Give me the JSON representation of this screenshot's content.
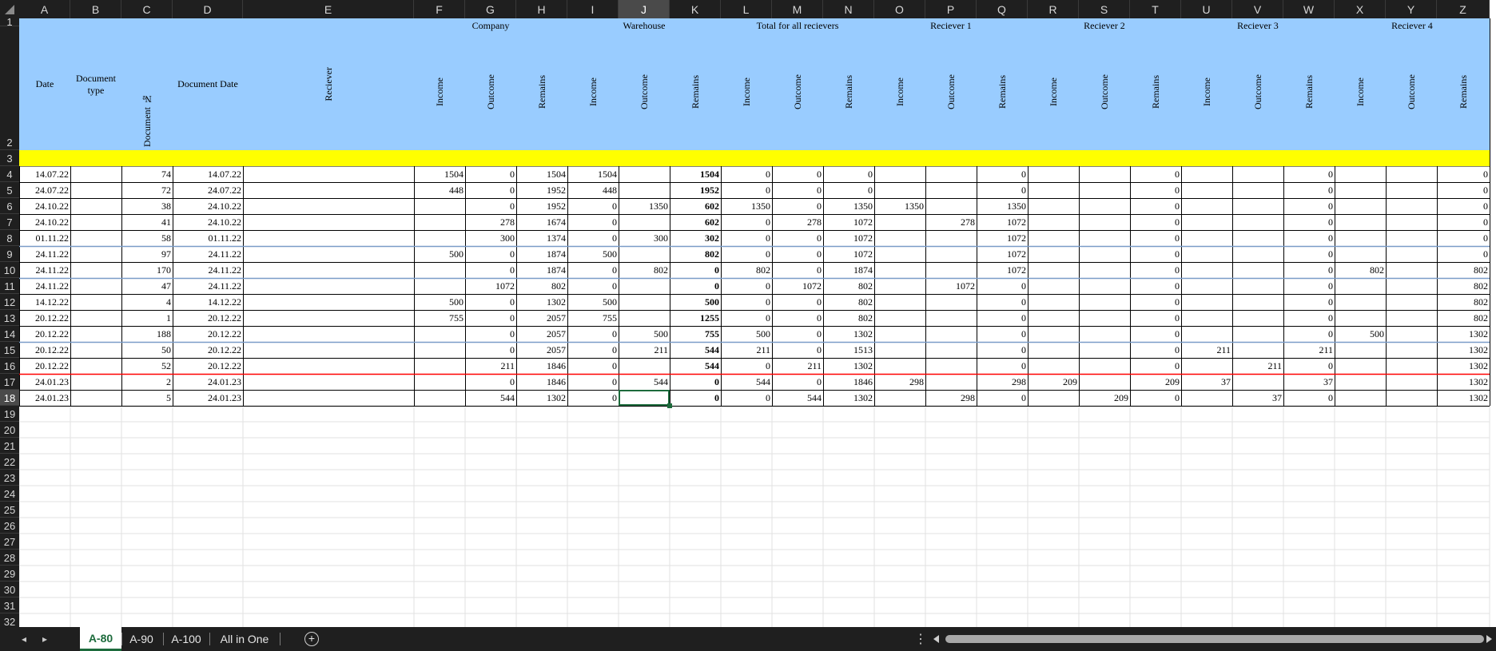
{
  "columns": [
    "A",
    "B",
    "C",
    "D",
    "E",
    "F",
    "G",
    "H",
    "I",
    "J",
    "K",
    "L",
    "M",
    "N",
    "O",
    "P",
    "Q",
    "R",
    "S",
    "T",
    "U",
    "V",
    "W",
    "X",
    "Y",
    "Z"
  ],
  "selected_column": "J",
  "selected_row": 18,
  "rows": [
    "1",
    "2",
    "3",
    "4",
    "5",
    "6",
    "7",
    "8",
    "9",
    "10",
    "11",
    "12",
    "13",
    "14",
    "15",
    "16",
    "17",
    "18",
    "19",
    "20",
    "21",
    "22",
    "23",
    "24",
    "25",
    "26",
    "27",
    "28",
    "29",
    "30",
    "31",
    "32"
  ],
  "headers": {
    "date": "Date",
    "document_type": "Document type",
    "document_no": "Document №",
    "document_date": "Document Date",
    "reciever": "Reciever",
    "groups": [
      "Company",
      "Warehouse",
      "Total for all recievers",
      "Reciever 1",
      "Reciever 2",
      "Reciever 3",
      "Reciever 4"
    ],
    "sub": [
      "Income",
      "Outcome",
      "Remains"
    ]
  },
  "colors": {
    "header_fill": "#99ccff",
    "highlight_row": "#ffff00",
    "red_line": "#ff0000",
    "blue_line": "#7a9cc8",
    "selection": "#1d6b3c"
  },
  "data_rows": [
    {
      "A": "14.07.22",
      "C": "74",
      "D": "14.07.22",
      "F": "1504",
      "G": "0",
      "H": "1504",
      "I": "1504",
      "J": "",
      "K": "1504",
      "L": "0",
      "M": "0",
      "N": "0",
      "O": "",
      "P": "",
      "Q": "0",
      "R": "",
      "S": "",
      "T": "0",
      "U": "",
      "V": "",
      "W": "0",
      "X": "",
      "Y": "",
      "Z": "0"
    },
    {
      "A": "24.07.22",
      "C": "72",
      "D": "24.07.22",
      "F": "448",
      "G": "0",
      "H": "1952",
      "I": "448",
      "J": "",
      "K": "1952",
      "L": "0",
      "M": "0",
      "N": "0",
      "O": "",
      "P": "",
      "Q": "0",
      "R": "",
      "S": "",
      "T": "0",
      "U": "",
      "V": "",
      "W": "0",
      "X": "",
      "Y": "",
      "Z": "0"
    },
    {
      "A": "24.10.22",
      "C": "38",
      "D": "24.10.22",
      "F": "",
      "G": "0",
      "H": "1952",
      "I": "0",
      "J": "1350",
      "K": "602",
      "L": "1350",
      "M": "0",
      "N": "1350",
      "O": "1350",
      "P": "",
      "Q": "1350",
      "R": "",
      "S": "",
      "T": "0",
      "U": "",
      "V": "",
      "W": "0",
      "X": "",
      "Y": "",
      "Z": "0"
    },
    {
      "A": "24.10.22",
      "C": "41",
      "D": "24.10.22",
      "F": "",
      "G": "278",
      "H": "1674",
      "I": "0",
      "J": "",
      "K": "602",
      "L": "0",
      "M": "278",
      "N": "1072",
      "O": "",
      "P": "278",
      "Q": "1072",
      "R": "",
      "S": "",
      "T": "0",
      "U": "",
      "V": "",
      "W": "0",
      "X": "",
      "Y": "",
      "Z": "0"
    },
    {
      "A": "01.11.22",
      "C": "58",
      "D": "01.11.22",
      "F": "",
      "G": "300",
      "H": "1374",
      "I": "0",
      "J": "300",
      "K": "302",
      "L": "0",
      "M": "0",
      "N": "1072",
      "O": "",
      "P": "",
      "Q": "1072",
      "R": "",
      "S": "",
      "T": "0",
      "U": "",
      "V": "",
      "W": "0",
      "X": "",
      "Y": "",
      "Z": "0"
    },
    {
      "A": "24.11.22",
      "C": "97",
      "D": "24.11.22",
      "F": "500",
      "G": "0",
      "H": "1874",
      "I": "500",
      "J": "",
      "K": "802",
      "L": "0",
      "M": "0",
      "N": "1072",
      "O": "",
      "P": "",
      "Q": "1072",
      "R": "",
      "S": "",
      "T": "0",
      "U": "",
      "V": "",
      "W": "0",
      "X": "",
      "Y": "",
      "Z": "0"
    },
    {
      "A": "24.11.22",
      "C": "170",
      "D": "24.11.22",
      "F": "",
      "G": "0",
      "H": "1874",
      "I": "0",
      "J": "802",
      "K": "0",
      "L": "802",
      "M": "0",
      "N": "1874",
      "O": "",
      "P": "",
      "Q": "1072",
      "R": "",
      "S": "",
      "T": "0",
      "U": "",
      "V": "",
      "W": "0",
      "X": "802",
      "Y": "",
      "Z": "802"
    },
    {
      "A": "24.11.22",
      "C": "47",
      "D": "24.11.22",
      "F": "",
      "G": "1072",
      "H": "802",
      "I": "0",
      "J": "",
      "K": "0",
      "L": "0",
      "M": "1072",
      "N": "802",
      "O": "",
      "P": "1072",
      "Q": "0",
      "R": "",
      "S": "",
      "T": "0",
      "U": "",
      "V": "",
      "W": "0",
      "X": "",
      "Y": "",
      "Z": "802"
    },
    {
      "A": "14.12.22",
      "C": "4",
      "D": "14.12.22",
      "F": "500",
      "G": "0",
      "H": "1302",
      "I": "500",
      "J": "",
      "K": "500",
      "L": "0",
      "M": "0",
      "N": "802",
      "O": "",
      "P": "",
      "Q": "0",
      "R": "",
      "S": "",
      "T": "0",
      "U": "",
      "V": "",
      "W": "0",
      "X": "",
      "Y": "",
      "Z": "802"
    },
    {
      "A": "20.12.22",
      "C": "1",
      "D": "20.12.22",
      "F": "755",
      "G": "0",
      "H": "2057",
      "I": "755",
      "J": "",
      "K": "1255",
      "L": "0",
      "M": "0",
      "N": "802",
      "O": "",
      "P": "",
      "Q": "0",
      "R": "",
      "S": "",
      "T": "0",
      "U": "",
      "V": "",
      "W": "0",
      "X": "",
      "Y": "",
      "Z": "802"
    },
    {
      "A": "20.12.22",
      "C": "188",
      "D": "20.12.22",
      "F": "",
      "G": "0",
      "H": "2057",
      "I": "0",
      "J": "500",
      "K": "755",
      "L": "500",
      "M": "0",
      "N": "1302",
      "O": "",
      "P": "",
      "Q": "0",
      "R": "",
      "S": "",
      "T": "0",
      "U": "",
      "V": "",
      "W": "0",
      "X": "500",
      "Y": "",
      "Z": "1302"
    },
    {
      "A": "20.12.22",
      "C": "50",
      "D": "20.12.22",
      "F": "",
      "G": "0",
      "H": "2057",
      "I": "0",
      "J": "211",
      "K": "544",
      "L": "211",
      "M": "0",
      "N": "1513",
      "O": "",
      "P": "",
      "Q": "0",
      "R": "",
      "S": "",
      "T": "0",
      "U": "211",
      "V": "",
      "W": "211",
      "X": "",
      "Y": "",
      "Z": "1302"
    },
    {
      "A": "20.12.22",
      "C": "52",
      "D": "20.12.22",
      "F": "",
      "G": "211",
      "H": "1846",
      "I": "0",
      "J": "",
      "K": "544",
      "L": "0",
      "M": "211",
      "N": "1302",
      "O": "",
      "P": "",
      "Q": "0",
      "R": "",
      "S": "",
      "T": "0",
      "U": "",
      "V": "211",
      "W": "0",
      "X": "",
      "Y": "",
      "Z": "1302"
    },
    {
      "A": "24.01.23",
      "C": "2",
      "D": "24.01.23",
      "F": "",
      "G": "0",
      "H": "1846",
      "I": "0",
      "J": "544",
      "K": "0",
      "L": "544",
      "M": "0",
      "N": "1846",
      "O": "298",
      "P": "",
      "Q": "298",
      "R": "209",
      "S": "",
      "T": "209",
      "U": "37",
      "V": "",
      "W": "37",
      "X": "",
      "Y": "",
      "Z": "1302"
    },
    {
      "A": "24.01.23",
      "C": "5",
      "D": "24.01.23",
      "F": "",
      "G": "544",
      "H": "1302",
      "I": "0",
      "J": "",
      "K": "0",
      "L": "0",
      "M": "544",
      "N": "1302",
      "O": "",
      "P": "298",
      "Q": "0",
      "R": "",
      "S": "209",
      "T": "0",
      "U": "",
      "V": "37",
      "W": "0",
      "X": "",
      "Y": "",
      "Z": "1302"
    }
  ],
  "tabs": [
    {
      "label": "A-80",
      "active": true
    },
    {
      "label": "A-90",
      "active": false
    },
    {
      "label": "A-100",
      "active": false
    },
    {
      "label": "All in One",
      "active": false
    }
  ],
  "icons": {
    "prev": "◂",
    "next": "▸",
    "add": "+",
    "more": "⋮"
  }
}
